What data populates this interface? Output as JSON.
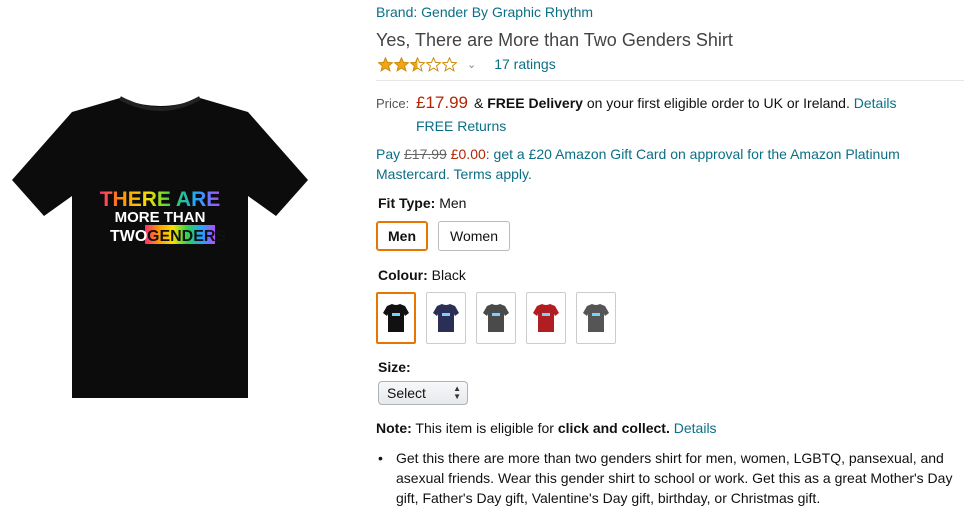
{
  "brand": "Brand: Gender By Graphic Rhythm",
  "title": "Yes, There are More than Two Genders Shirt",
  "rating": {
    "stars": 2.5,
    "max": 5,
    "ratings_text": "17 ratings"
  },
  "shirt_print": {
    "line1": "THERE ARE",
    "line2": "MORE THAN",
    "line3a": "TWO",
    "line3b": "GENDERS"
  },
  "price": {
    "label": "Price:",
    "value": "£17.99",
    "amp": "&",
    "delivery_bold": "FREE Delivery",
    "delivery_rest": "on your first eligible order to UK or Ireland.",
    "details_link": "Details",
    "returns": "FREE Returns"
  },
  "promo": {
    "pay": "Pay",
    "old_price": "£17.99",
    "new_price": "£0.00",
    "rest": ": get a £20 Amazon Gift Card on approval for the Amazon Platinum Mastercard. Terms apply."
  },
  "fit": {
    "label": "Fit Type:",
    "value": "Men",
    "options": [
      "Men",
      "Women"
    ]
  },
  "colour": {
    "label": "Colour:",
    "value": "Black",
    "swatches": [
      "#111111",
      "#2c2f55",
      "#4a4a4a",
      "#b01e22",
      "#555555"
    ]
  },
  "size": {
    "label": "Size:",
    "select_value": "Select"
  },
  "note": {
    "label": "Note:",
    "text": "This item is eligible for",
    "bold": "click and collect.",
    "link": "Details"
  },
  "bullets": [
    "Get this there are more than two genders shirt for men, women, LGBTQ, pansexual, and asexual friends. Wear this gender shirt to school or work. Get this as a great Mother's Day gift, Father's Day gift, Valentine's Day gift, birthday, or Christmas gift."
  ],
  "colors": {
    "link": "#0a6f86",
    "price": "#b12704",
    "selected_border": "#e77600",
    "star": "#f0a51a"
  }
}
